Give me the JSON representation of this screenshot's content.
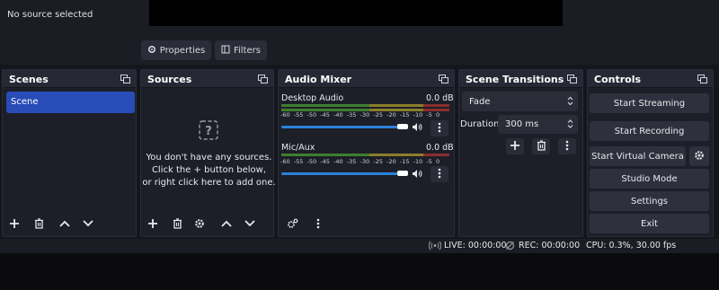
{
  "context_bar": {
    "source_label": "No source selected",
    "properties_label": "Properties",
    "filters_label": "Filters"
  },
  "docks": {
    "scenes": {
      "title": "Scenes",
      "items": [
        "Scene"
      ]
    },
    "sources": {
      "title": "Sources",
      "empty_line1": "You don't have any sources.",
      "empty_line2": "Click the + button below,",
      "empty_line3": "or right click here to add one."
    },
    "mixer": {
      "title": "Audio Mixer",
      "ticks": [
        "-60",
        "-55",
        "-50",
        "-45",
        "-40",
        "-35",
        "-30",
        "-25",
        "-20",
        "-15",
        "-10",
        "-5",
        "0"
      ],
      "channels": [
        {
          "name": "Desktop Audio",
          "db": "0.0 dB"
        },
        {
          "name": "Mic/Aux",
          "db": "0.0 dB"
        }
      ]
    },
    "transitions": {
      "title": "Scene Transitions",
      "selected": "Fade",
      "duration_label": "Duration",
      "duration_value": "300 ms"
    },
    "controls": {
      "title": "Controls",
      "start_streaming": "Start Streaming",
      "start_recording": "Start Recording",
      "start_virtual_camera": "Start Virtual Camera",
      "studio_mode": "Studio Mode",
      "settings": "Settings",
      "exit": "Exit"
    }
  },
  "status": {
    "live": "LIVE: 00:00:00",
    "rec": "REC: 00:00:00",
    "cpu": "CPU: 0.3%, 30.00 fps"
  },
  "colors": {
    "accent": "#284cb8",
    "slider": "#2a82dc",
    "meter_green": "#4fa83a",
    "meter_yellow": "#b5a33a",
    "meter_red": "#b03a3a"
  }
}
